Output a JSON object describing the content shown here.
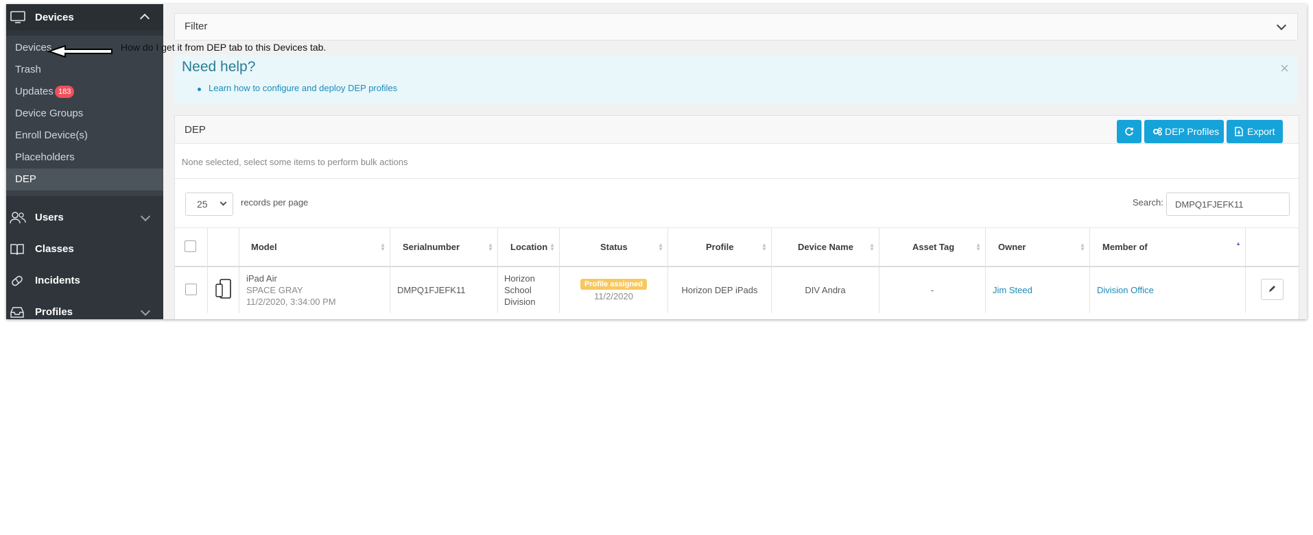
{
  "sidebar": {
    "header": {
      "label": "Devices",
      "icon": "monitor-icon"
    },
    "sub_items": [
      {
        "label": "Devices"
      },
      {
        "label": "Trash"
      },
      {
        "label": "Updates",
        "badge": "183"
      },
      {
        "label": "Device Groups"
      },
      {
        "label": "Enroll Device(s)"
      },
      {
        "label": "Placeholders"
      },
      {
        "label": "DEP",
        "active": true
      }
    ],
    "nav": [
      {
        "label": "Users",
        "icon": "users-icon"
      },
      {
        "label": "Classes",
        "icon": "book-icon"
      },
      {
        "label": "Incidents",
        "icon": "pill-icon"
      },
      {
        "label": "Profiles",
        "icon": "inbox-icon"
      }
    ]
  },
  "annotation": {
    "text": "How do I get it from DEP tab to this Devices tab."
  },
  "filter": {
    "label": "Filter"
  },
  "help": {
    "title": "Need help?",
    "link": "Learn how to configure and deploy DEP profiles",
    "close": "×"
  },
  "card": {
    "title": "DEP",
    "buttons": {
      "refresh_icon": "refresh-icon",
      "profiles": "DEP Profiles",
      "export": "Export"
    },
    "bulk_text": "None selected, select some items to perform bulk actions",
    "records": {
      "value": "25",
      "label": "records per page"
    },
    "search": {
      "label": "Search:",
      "value": "DMPQ1FJEFK11"
    }
  },
  "table": {
    "headers": [
      "Model",
      "Serialnumber",
      "Location",
      "Status",
      "Profile",
      "Device Name",
      "Asset Tag",
      "Owner",
      "Member of"
    ],
    "row": {
      "model": "iPad Air",
      "color": "SPACE GRAY",
      "date": "11/2/2020, 3:34:00 PM",
      "serial": "DMPQ1FJEFK11",
      "location": [
        "Horizon",
        "School",
        "Division"
      ],
      "status_badge": "Profile assigned",
      "status_date": "11/2/2020",
      "profile": "Horizon DEP iPads",
      "device_name": "DIV Andra",
      "asset_tag": "-",
      "owner": "Jim Steed",
      "member_of": "Division Office"
    }
  }
}
